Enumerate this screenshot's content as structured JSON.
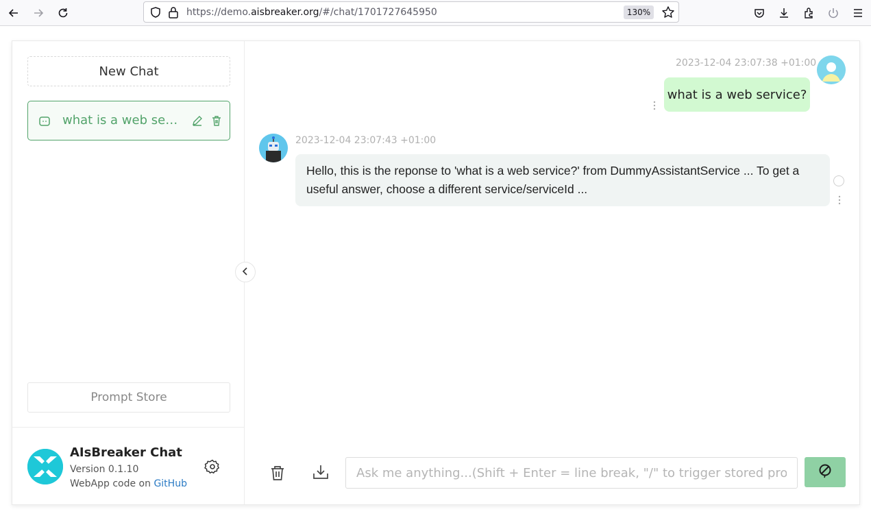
{
  "browser": {
    "url_prefix": "https://demo.",
    "url_domain": "aisbreaker.org",
    "url_suffix": "/#/chat/1701727645950",
    "zoom": "130%"
  },
  "sidebar": {
    "new_chat_label": "New Chat",
    "chats": [
      {
        "title": "what is a web service?"
      }
    ],
    "prompt_store_label": "Prompt Store",
    "footer": {
      "app_name": "AIsBreaker Chat",
      "version": "Version 0.1.10",
      "webapp_code_prefix": "WebApp code on",
      "github_label": "GitHub"
    }
  },
  "conversation": {
    "messages": [
      {
        "role": "user",
        "timestamp": "2023-12-04 23:07:38 +01:00",
        "text": "what is a web service?"
      },
      {
        "role": "assistant",
        "timestamp": "2023-12-04 23:07:43 +01:00",
        "text": "Hello, this is the reponse to 'what is a web service?' from DummyAssistantService ... To get a useful answer, choose a different service/serviceId ..."
      }
    ]
  },
  "input": {
    "placeholder": "Ask me anything...(Shift + Enter = line break, \"/\" to trigger stored prompts)",
    "value": ""
  },
  "colors": {
    "accent_green": "#52a36a",
    "user_bubble": "#d2f9d1",
    "bot_bubble": "#f0f4f3",
    "send_button": "#8fd1a4"
  }
}
